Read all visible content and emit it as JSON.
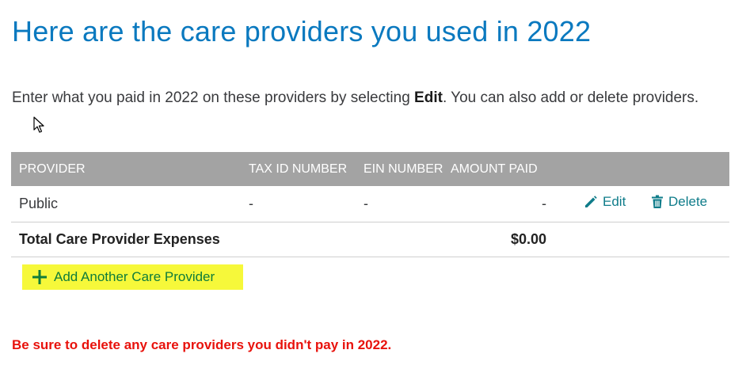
{
  "page": {
    "title": "Here are the care providers you used in 2022",
    "intro_before": "Enter what you paid in 2022 on these providers by selecting ",
    "intro_bold": "Edit",
    "intro_after": ". You can also add or delete providers."
  },
  "table": {
    "headers": {
      "provider": "PROVIDER",
      "tax_id": "TAX ID NUMBER",
      "ein": "EIN NUMBER",
      "amount": "AMOUNT PAID"
    },
    "rows": [
      {
        "provider": "Public",
        "tax_id": "-",
        "ein": "-",
        "amount": "-",
        "edit_label": "Edit",
        "delete_label": "Delete"
      }
    ],
    "total": {
      "label": "Total Care Provider Expenses",
      "amount": "$0.00"
    }
  },
  "actions": {
    "add_label": "Add Another Care Provider"
  },
  "warning": "Be sure to delete any care providers you didn't pay in 2022.",
  "icons": {
    "edit": "pencil-icon",
    "delete": "trash-icon",
    "add": "plus-icon",
    "cursor": "mouse-pointer-icon"
  },
  "colors": {
    "title": "#0a79bf",
    "header_bg": "#a3a3a3",
    "action_link": "#0f7c8a",
    "add_highlight": "#f6f83a",
    "add_text": "#0f7c3a",
    "warning": "#e8120c"
  }
}
